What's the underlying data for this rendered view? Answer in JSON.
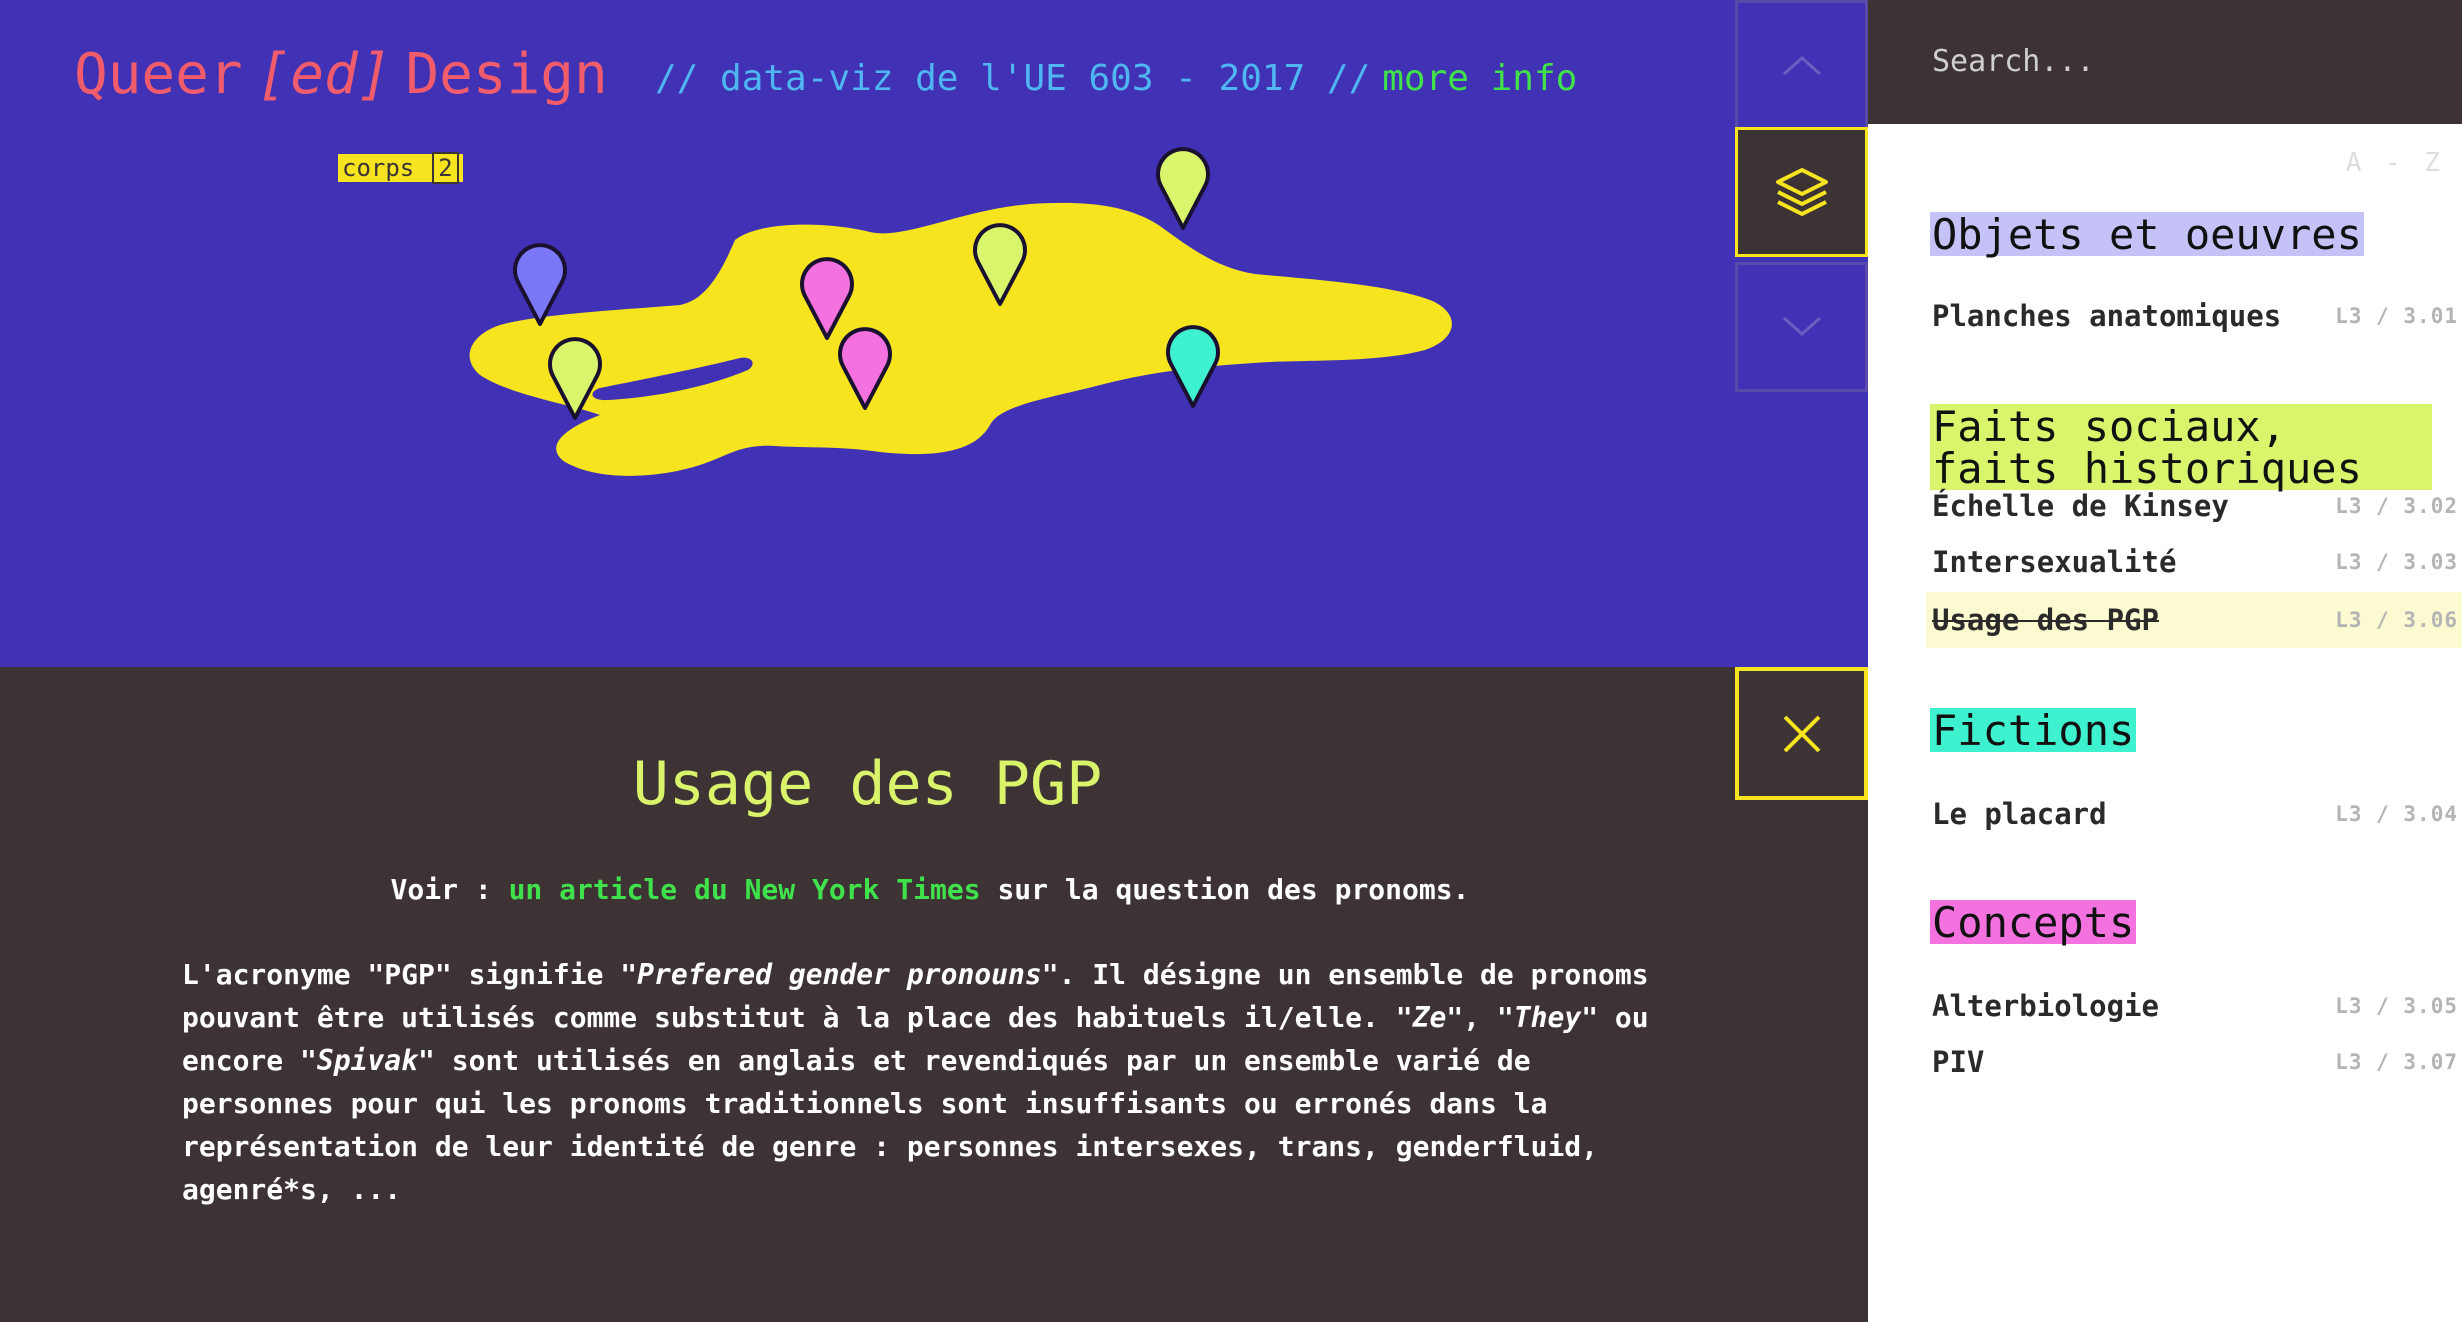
{
  "header": {
    "title_part1": "Queer",
    "title_italic": "[ed]",
    "title_part2": "Design",
    "subtitle": "// data-viz de l'UE 603 - 2017 //",
    "more_info": "more info"
  },
  "map": {
    "tag_label": "corps",
    "tag_count": "2",
    "colors": {
      "blob": "#f5e41e",
      "background": "#4131b5"
    },
    "markers": [
      {
        "name": "marker-blue",
        "color": "#7a78f6"
      },
      {
        "name": "marker-lime-1",
        "color": "#d8f56c"
      },
      {
        "name": "marker-pink-1",
        "color": "#f372e0"
      },
      {
        "name": "marker-pink-2",
        "color": "#f372e0"
      },
      {
        "name": "marker-lime-2",
        "color": "#d8f56c"
      },
      {
        "name": "marker-lime-3",
        "color": "#d8f56c"
      },
      {
        "name": "marker-teal",
        "color": "#3ff2cf"
      }
    ]
  },
  "nav": {
    "up_icon": "chevron-up-icon",
    "layers_icon": "layers-icon",
    "down_icon": "chevron-down-icon",
    "close_icon": "close-icon"
  },
  "article": {
    "title": "Usage des PGP",
    "see_prefix": "Voir :",
    "see_link": "un article du New York Times",
    "see_suffix": "sur la question des pronoms.",
    "body_1": "L'acronyme \"PGP\" signifie \"",
    "body_em_1": "Prefered gender pronouns",
    "body_2": "\". Il désigne un ensemble de pronoms pouvant être utilisés comme substitut à la place des habituels il/elle. \"",
    "body_em_2": "Ze",
    "body_3": "\", \"",
    "body_em_3": "They",
    "body_4": "\" ou encore \"",
    "body_em_4": "Spivak",
    "body_5": "\" sont utilisés en anglais et revendiqués par un ensemble varié de personnes pour qui les pronoms traditionnels sont insuffisants ou erronés dans la représentation de leur identité de genre : personnes intersexes, trans, genderfluid, agenré*s, ..."
  },
  "sidebar": {
    "search_placeholder": "Search...",
    "sort_label": "A - Z",
    "categories": [
      {
        "heading": "Objets et oeuvres",
        "color": "#c4c2f6",
        "entries": [
          {
            "name": "Planches anatomiques",
            "code": "L3 / 3.01"
          }
        ]
      },
      {
        "heading_line1": "Faits sociaux,",
        "heading_line2": "faits historiques",
        "color": "#d8f56c",
        "entries": [
          {
            "name": "Échelle de Kinsey",
            "code": "L3 / 3.02"
          },
          {
            "name": "Intersexualité",
            "code": "L3 / 3.03"
          },
          {
            "name": "Usage des PGP",
            "code": "L3 / 3.06",
            "active": true
          }
        ]
      },
      {
        "heading": "Fictions",
        "color": "#3ff2cf",
        "entries": [
          {
            "name": "Le placard",
            "code": "L3 / 3.04"
          }
        ]
      },
      {
        "heading": "Concepts",
        "color": "#f372e0",
        "entries": [
          {
            "name": "Alterbiologie",
            "code": "L3 / 3.05"
          },
          {
            "name": "PIV",
            "code": "L3 / 3.07"
          }
        ]
      }
    ]
  }
}
